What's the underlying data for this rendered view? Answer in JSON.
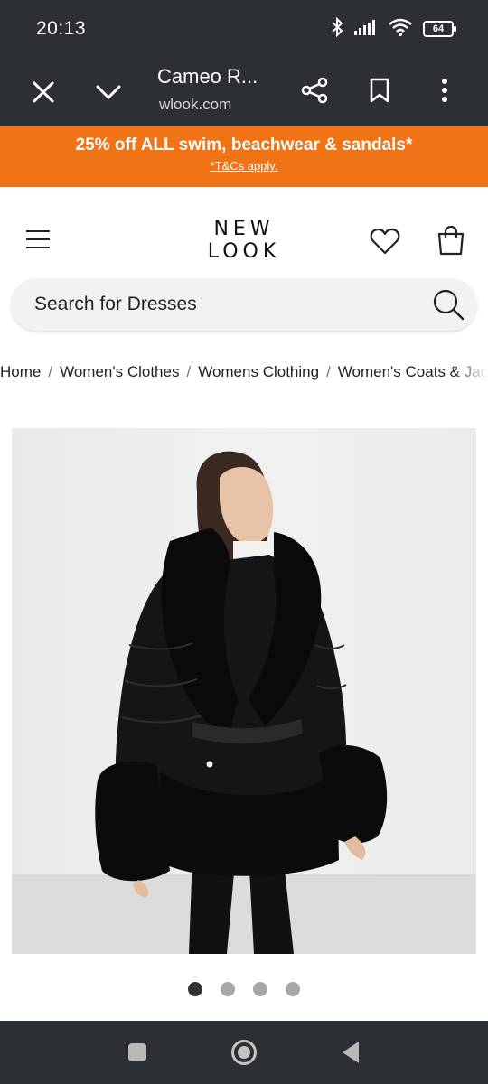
{
  "status_bar": {
    "time": "20:13",
    "battery": "64",
    "icons": [
      "bluetooth-icon",
      "signal-icon",
      "wifi-icon",
      "battery-icon"
    ]
  },
  "browser": {
    "tab_title": "Cameo R...",
    "url": "wlook.com",
    "icons": [
      "close-icon",
      "chevron-down-icon",
      "share-icon",
      "bookmark-icon",
      "more-icon"
    ]
  },
  "promo": {
    "headline": "25% off ALL swim, beachwear & sandals*",
    "subtext": "*T&Cs apply.",
    "background": "#f07315"
  },
  "header": {
    "logo_line1": "NEW",
    "logo_line2": "LOOK",
    "icons": [
      "menu-icon",
      "heart-icon",
      "bag-icon"
    ]
  },
  "search": {
    "placeholder": "Search for Dresses"
  },
  "breadcrumb": {
    "items": [
      "Home",
      "Women's Clothes",
      "Womens Clothing",
      "Women's Coats & Jackets"
    ],
    "separator": "/"
  },
  "carousel": {
    "total": 4,
    "active_index": 0
  },
  "nav_bar": {
    "icons": [
      "recents-icon",
      "home-icon",
      "back-icon"
    ]
  }
}
